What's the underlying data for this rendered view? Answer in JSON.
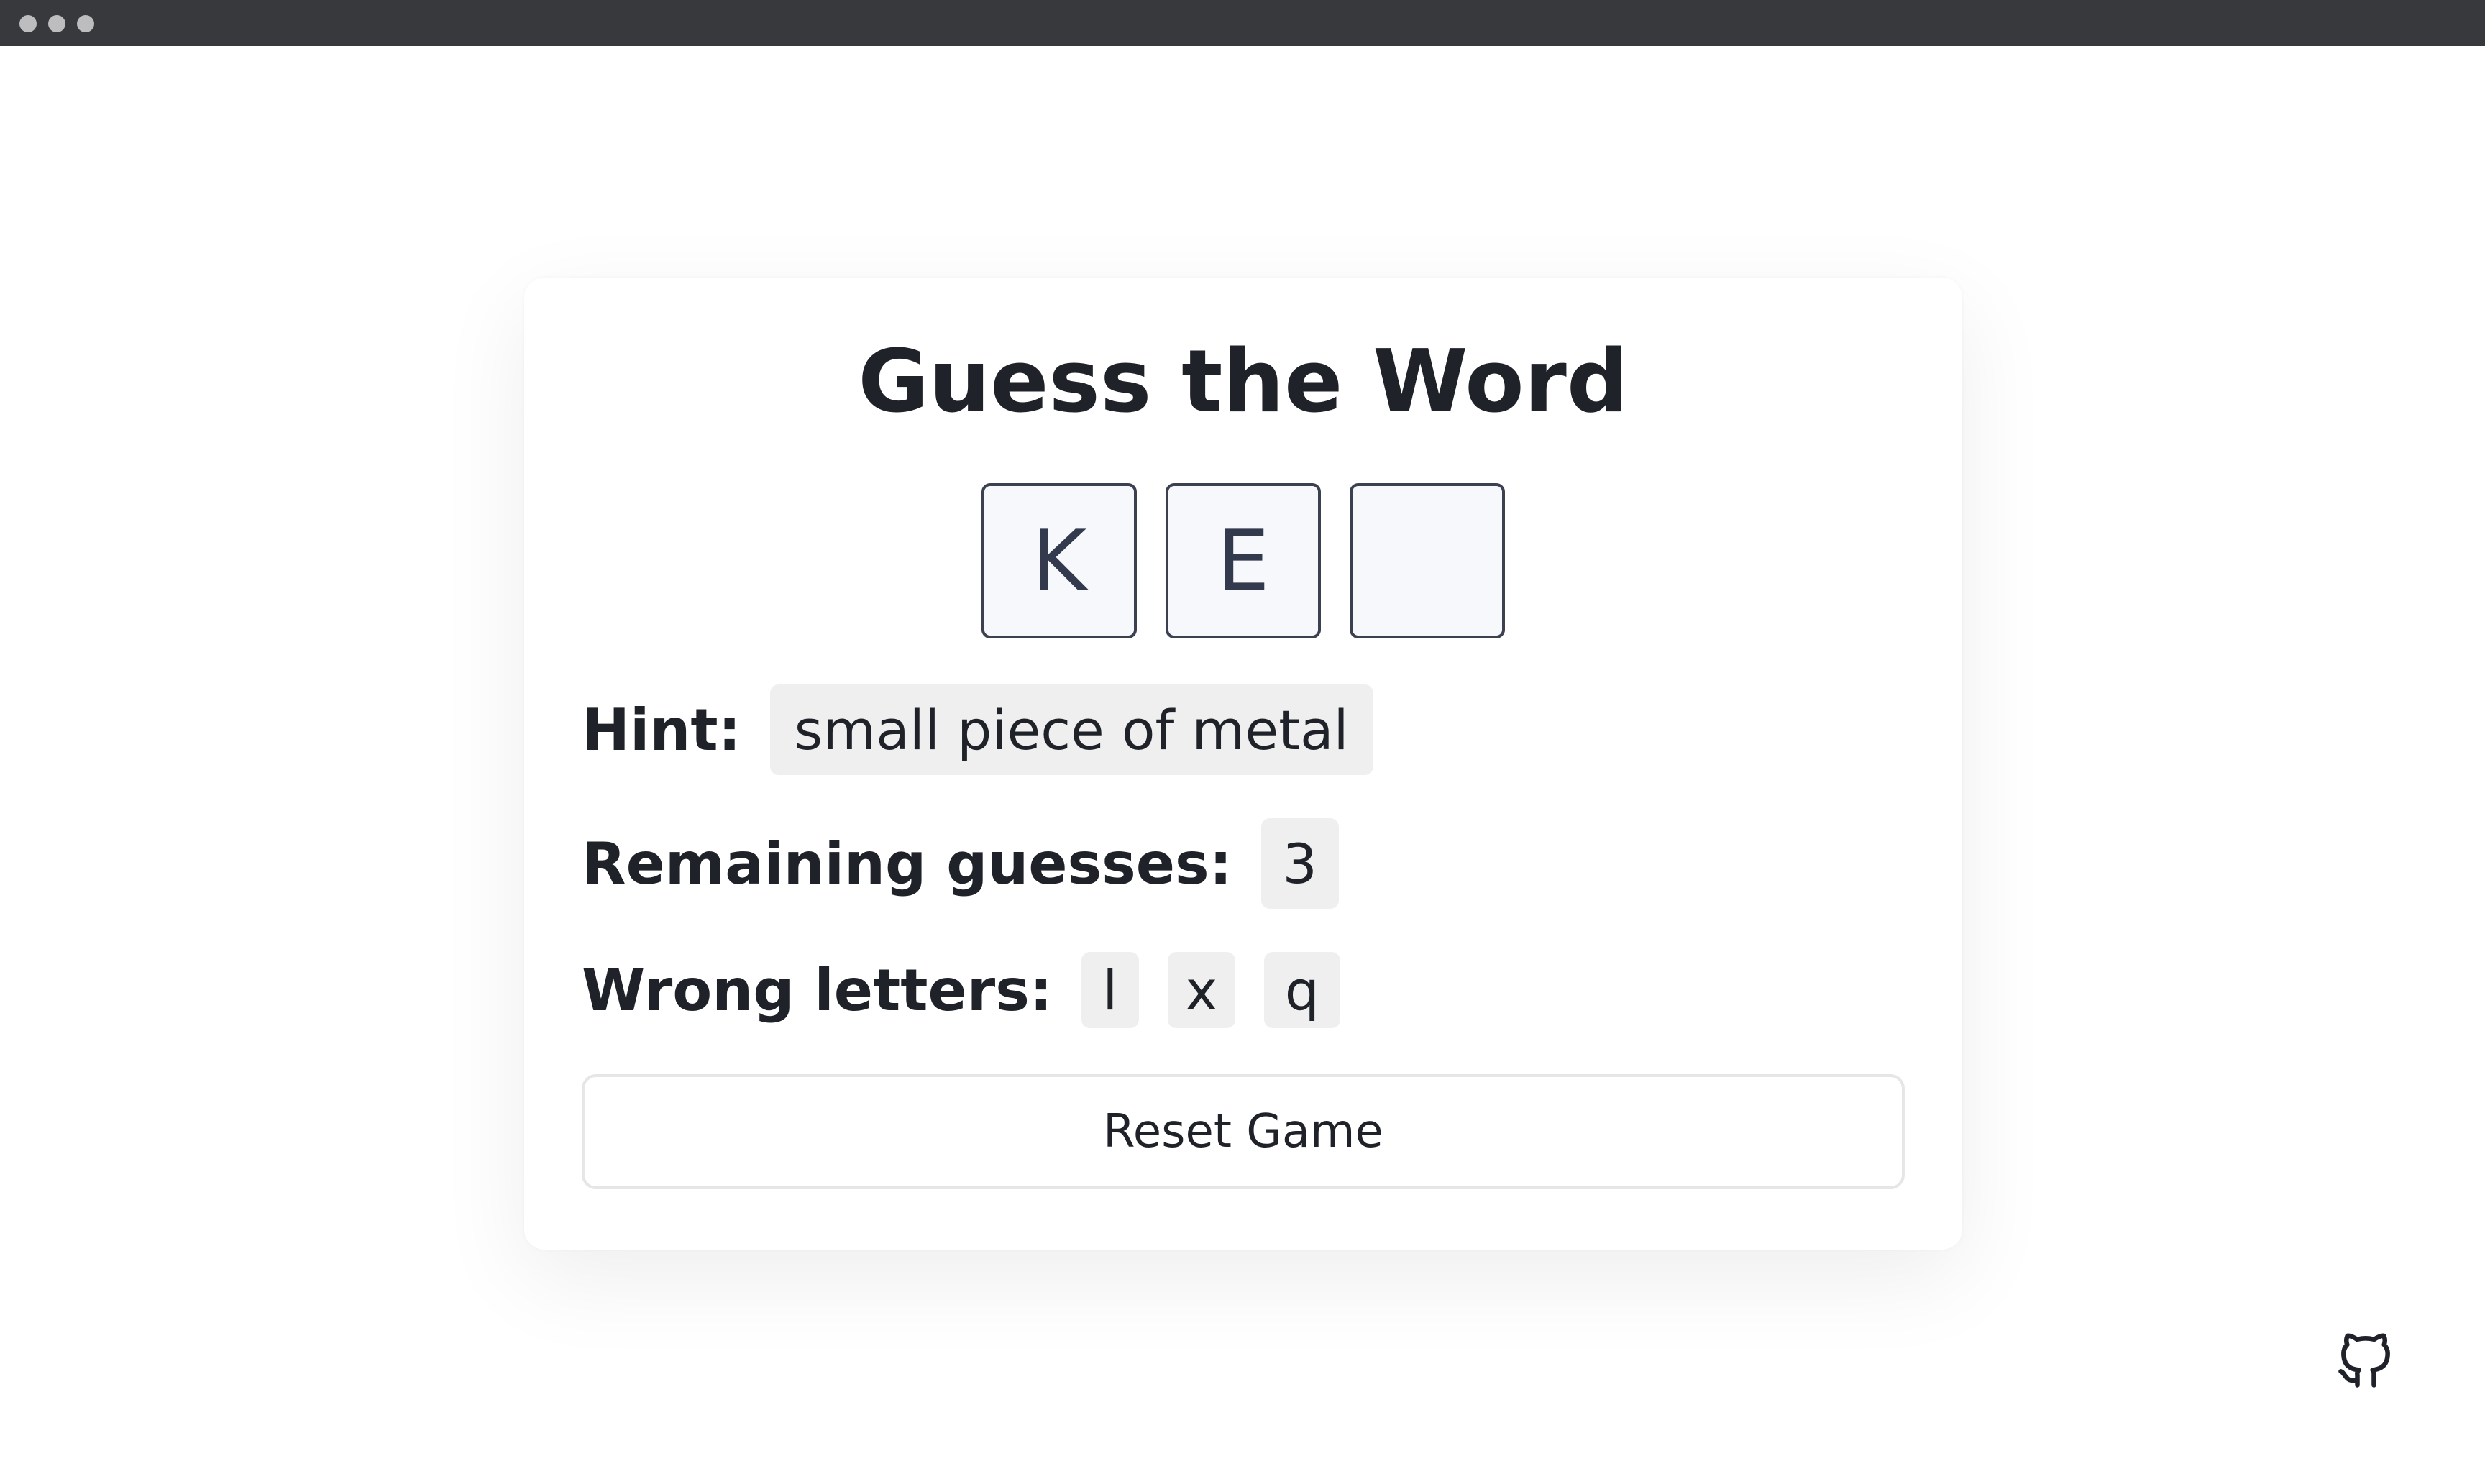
{
  "window": {
    "controls": [
      "close-dot",
      "minimize-dot",
      "maximize-dot"
    ]
  },
  "game": {
    "title": "Guess the Word",
    "tiles": [
      "K",
      "E",
      ""
    ],
    "hint_label": "Hint:",
    "hint_value": "small piece of metal",
    "remaining_label": "Remaining guesses:",
    "remaining_value": "3",
    "wrong_label": "Wrong letters:",
    "wrong_letters": [
      "l",
      "x",
      "q"
    ],
    "reset_label": "Reset Game"
  },
  "footer": {
    "icon": "github-icon"
  },
  "colors": {
    "titlebar": "#38393c",
    "tile_border": "#3b4151",
    "tile_fill": "#f6f8fb",
    "chip_fill": "#efefef"
  }
}
